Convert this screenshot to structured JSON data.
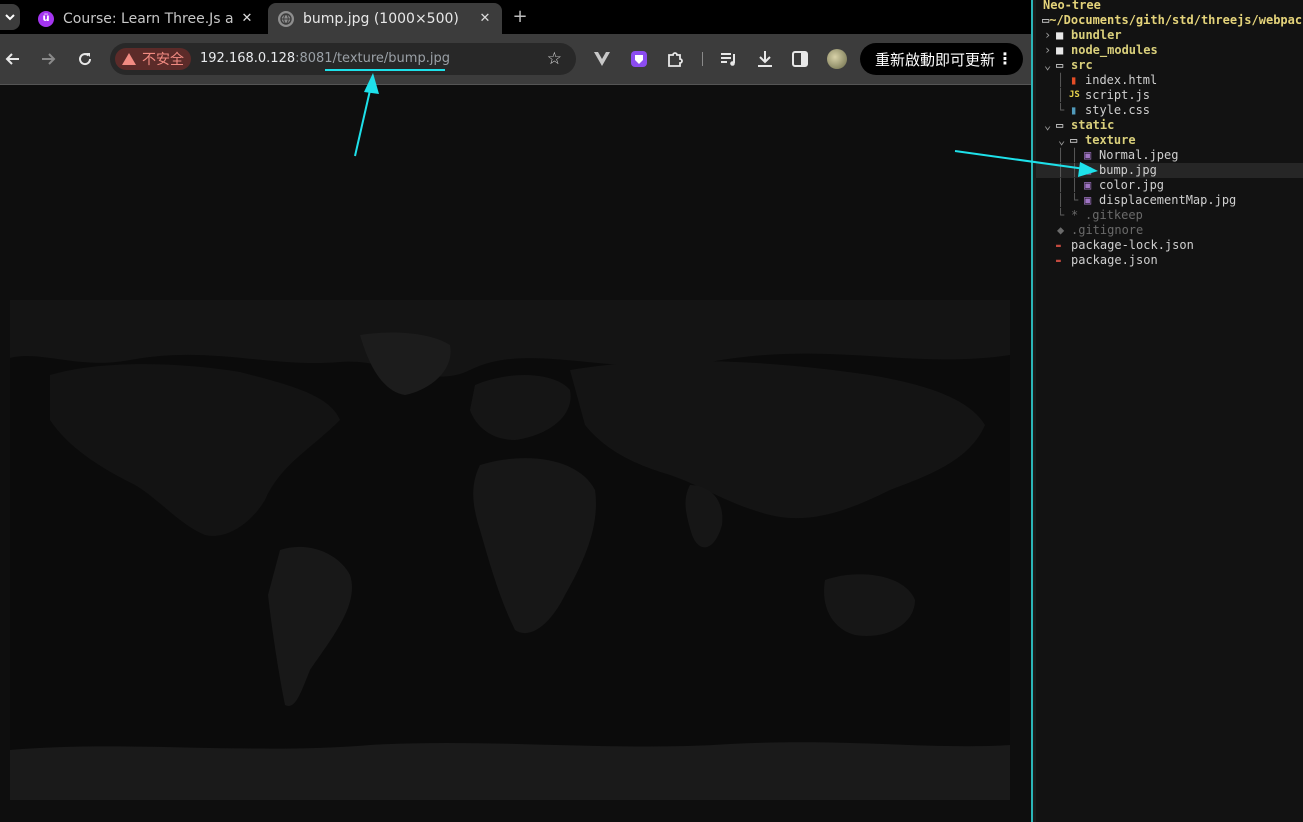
{
  "browser": {
    "tabs": [
      {
        "title": "Course: Learn Three.Js a",
        "close": "✕",
        "active": false
      },
      {
        "title": "bump.jpg (1000×500)",
        "close": "✕",
        "active": true
      }
    ],
    "new_tab_label": "+",
    "omnibox": {
      "security_label": "不安全",
      "url_host": "192.168.0.128",
      "url_rest": ":8081/texture/bump.jpg"
    },
    "update_button_label": "重新啟動即可更新",
    "update_menu_label": "⋮",
    "icons": [
      "tab-list-icon",
      "back-icon",
      "forward-icon",
      "reload-icon",
      "star-icon",
      "vue-devtools-icon",
      "shield-extension-icon",
      "puzzle-extensions-icon",
      "media-controls-icon",
      "download-icon",
      "side-panel-icon",
      "profile-avatar"
    ]
  },
  "colors": {
    "accent_cyan": "#1ee1ea",
    "neotree_header": "#e4d37a",
    "insecure_red": "#f28b82"
  },
  "neotree": {
    "header": "Neo-tree",
    "root_path": "~/Documents/gith/std/threejs/webpack",
    "items": [
      {
        "chev": "›",
        "icon": "folder",
        "label": "bundler",
        "kind": "dir"
      },
      {
        "chev": "›",
        "icon": "folder",
        "label": "node_modules",
        "kind": "dir"
      },
      {
        "chev": "⌄",
        "icon": "open-folder",
        "label": "src",
        "kind": "dir"
      },
      {
        "icon": "html",
        "label": "index.html",
        "kind": "file"
      },
      {
        "icon": "js",
        "icon_text": "JS",
        "label": "script.js",
        "kind": "file"
      },
      {
        "icon": "css",
        "label": "style.css",
        "kind": "file"
      },
      {
        "chev": "⌄",
        "icon": "open-folder",
        "label": "static",
        "kind": "dir"
      },
      {
        "chev": "⌄",
        "icon": "open-folder",
        "label": "texture",
        "kind": "dir"
      },
      {
        "icon": "image",
        "label": "Normal.jpeg",
        "kind": "file"
      },
      {
        "icon": "image",
        "label": "bump.jpg",
        "kind": "file",
        "selected": true
      },
      {
        "icon": "image",
        "label": "color.jpg",
        "kind": "file"
      },
      {
        "icon": "image",
        "label": "displacementMap.jpg",
        "kind": "file"
      },
      {
        "icon": "asterisk",
        "icon_text": "*",
        "label": ".gitkeep",
        "kind": "dim"
      },
      {
        "icon": "git",
        "icon_text": "◆",
        "label": ".gitignore",
        "kind": "dim"
      },
      {
        "icon": "json",
        "label": "package-lock.json",
        "kind": "file"
      },
      {
        "icon": "json",
        "label": "package.json",
        "kind": "file"
      }
    ]
  }
}
